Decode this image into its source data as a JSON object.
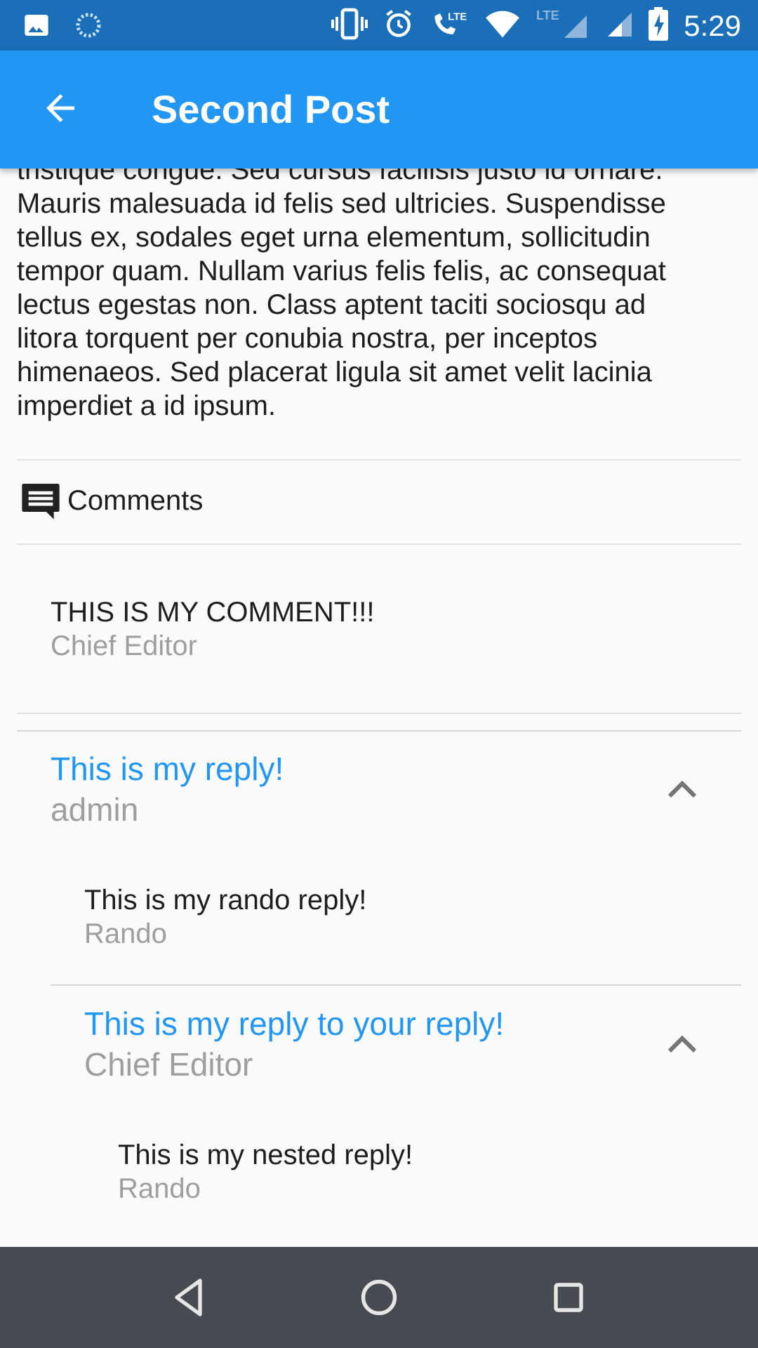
{
  "status_bar": {
    "time": "5:29",
    "icons": [
      "image-icon",
      "sync-icon",
      "vibrate-icon",
      "alarm-icon",
      "lte-call-icon",
      "wifi-icon",
      "lte-signal-icon",
      "signal-icon",
      "battery-charging-icon"
    ]
  },
  "app_bar": {
    "title": "Second Post",
    "back_icon": "arrow-back-icon"
  },
  "post": {
    "lines": [
      "tristique congue. Sed cursus facilisis justo id ornare.",
      "Mauris malesuada id felis sed ultricies. Suspendisse",
      "tellus ex, sodales eget urna elementum, sollicitudin",
      "tempor quam. Nullam varius felis felis, ac consequat",
      "lectus egestas non. Class aptent taciti sociosqu ad",
      "litora torquent per conubia nostra, per inceptos",
      "himenaeos. Sed placerat ligula sit amet velit lacinia",
      "imperdiet a id ipsum."
    ]
  },
  "comments": {
    "label": "Comments",
    "icon": "comment-icon",
    "items": [
      {
        "text": "THIS IS MY COMMENT!!!",
        "author": "Chief Editor"
      }
    ],
    "reply_thread": {
      "text": "This is my reply!",
      "author": "admin",
      "replies": [
        {
          "text": "This is my rando reply!",
          "author": "Rando"
        }
      ],
      "nested_thread": {
        "text": "This is my reply to your reply!",
        "author": "Chief Editor",
        "replies": [
          {
            "text": "This is my nested reply!",
            "author": "Rando"
          }
        ]
      }
    }
  },
  "colors": {
    "primary": "#2196f3",
    "status_bar": "#1a6fb8",
    "nav_bar": "#454b51",
    "secondary_text": "#9e9e9e"
  }
}
